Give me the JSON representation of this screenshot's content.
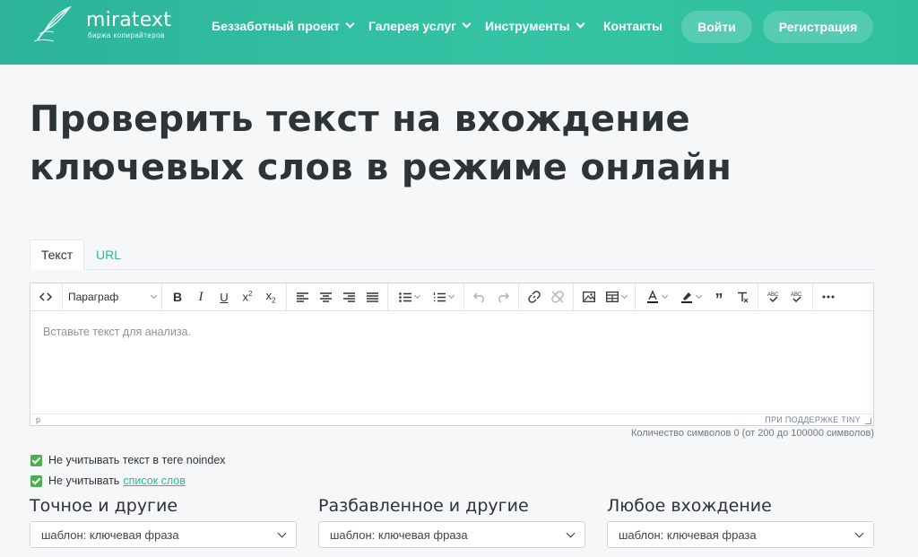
{
  "header": {
    "logo_text": "miratext",
    "logo_sub": "биржа копирайтеров",
    "nav": [
      {
        "label": "Беззаботный проект"
      },
      {
        "label": "Галерея услуг"
      },
      {
        "label": "Инструменты"
      },
      {
        "label": "Контакты"
      }
    ],
    "login": "Войти",
    "register": "Регистрация",
    "accent": "#34bfa2"
  },
  "page": {
    "title_line1": "Проверить текст на вхождение",
    "title_line2": "ключевых слов в режиме онлайн"
  },
  "tabs": {
    "text": "Текст",
    "url": "URL"
  },
  "editor": {
    "paragraph_select": "Параграф",
    "placeholder": "Вставьте текст для анализа.",
    "status_path": "p",
    "powered": "ПРИ ПОДДЕРЖКЕ TINY",
    "toolbar_icons": [
      "code-icon",
      "bold-icon",
      "italic-icon",
      "underline-icon",
      "superscript-icon",
      "subscript-icon",
      "align-left-icon",
      "align-center-icon",
      "align-right-icon",
      "align-justify-icon",
      "bullet-list-icon",
      "numbered-list-icon",
      "undo-icon",
      "redo-icon",
      "link-icon",
      "unlink-icon",
      "image-icon",
      "table-icon",
      "text-color-icon",
      "highlight-icon",
      "blockquote-icon",
      "clear-format-icon",
      "spellcheck-icon",
      "spellcheck-language-icon",
      "more-icon"
    ]
  },
  "char_count": {
    "prefix": "Количество символов",
    "value": "0",
    "suffix": "(от 200 до 100000 символов)"
  },
  "options": {
    "noindex": "Не учитывать текст в теге noindex",
    "ignore_prefix": "Не учитывать",
    "ignore_link": "список слов"
  },
  "selects": [
    {
      "label": "Точное и другие",
      "value": "шаблон: ключевая фраза"
    },
    {
      "label": "Разбавленное и другие",
      "value": "шаблон: ключевая фраза"
    },
    {
      "label": "Любое вхождение",
      "value": "шаблон: ключевая фраза"
    }
  ]
}
